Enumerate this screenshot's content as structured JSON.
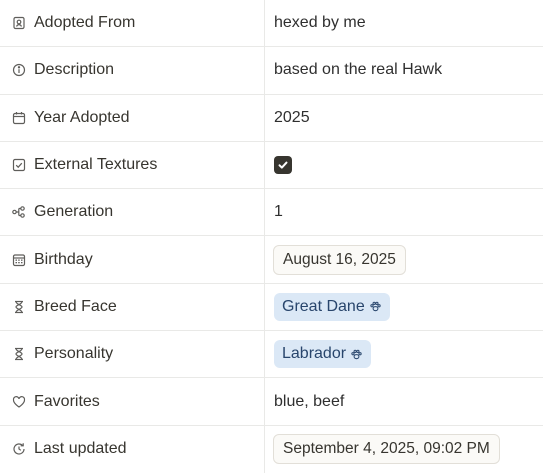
{
  "rows": [
    {
      "label": "Adopted From",
      "icon": "contact-card-icon",
      "value": "hexed by me"
    },
    {
      "label": "Description",
      "icon": "info-icon",
      "value": "based on the real Hawk"
    },
    {
      "label": "Year Adopted",
      "icon": "calendar-icon",
      "value": "2025"
    },
    {
      "label": "External Textures",
      "icon": "checkbox-icon",
      "value": true
    },
    {
      "label": "Generation",
      "icon": "relation-icon",
      "value": "1"
    },
    {
      "label": "Birthday",
      "icon": "date-icon",
      "value": "August 16, 2025"
    },
    {
      "label": "Breed Face",
      "icon": "rollup-icon",
      "value": "Great Dane"
    },
    {
      "label": "Personality",
      "icon": "rollup-icon",
      "value": "Labrador"
    },
    {
      "label": "Favorites",
      "icon": "heart-icon",
      "value": "blue, beef"
    },
    {
      "label": "Last updated",
      "icon": "clock-icon",
      "value": "September 4, 2025, 09:02 PM"
    }
  ],
  "colors": {
    "tag_bg": "#dbe8f6",
    "tag_text": "#28456c",
    "checkbox": "#37352f"
  }
}
